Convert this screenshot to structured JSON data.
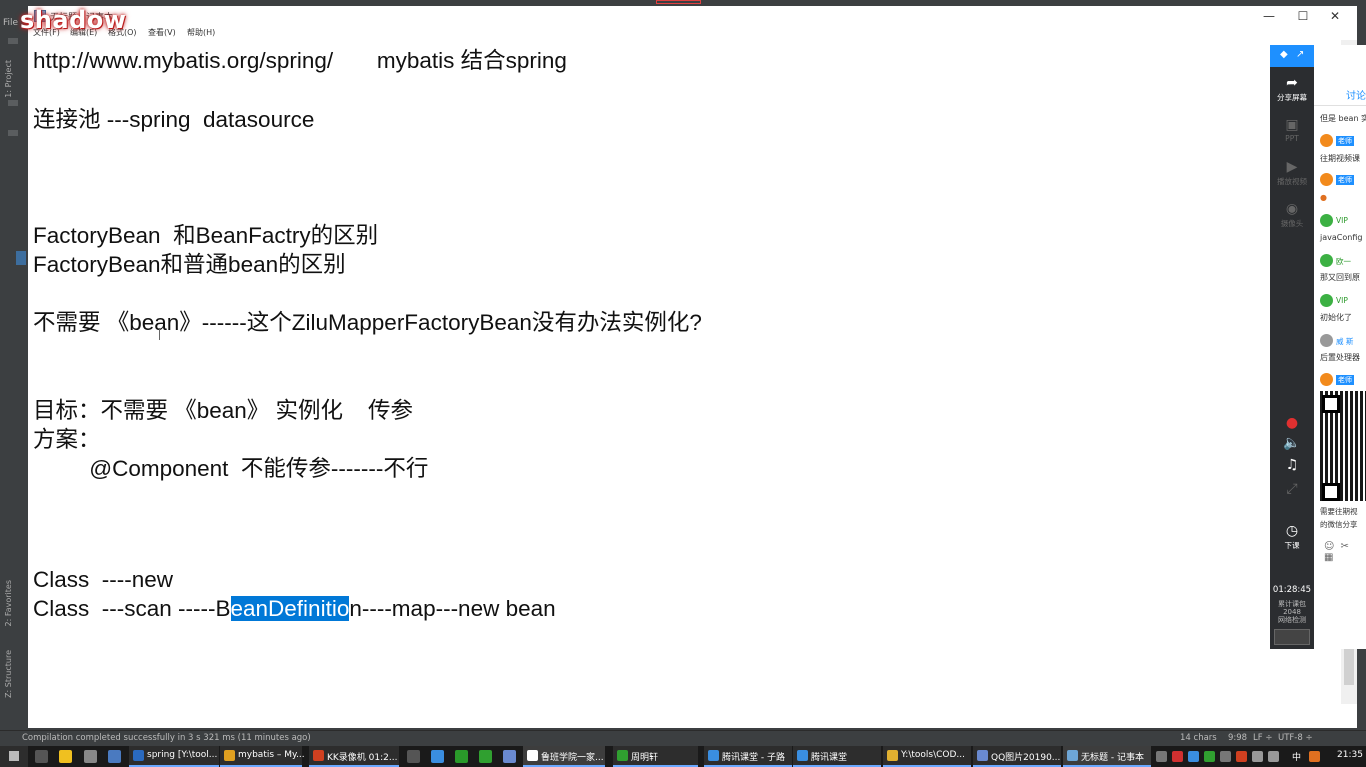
{
  "ide": {
    "tab_label": "sp",
    "menu_label": "File",
    "side_tabs": [
      "1: Project",
      "2: Favorites",
      "Z: Structure"
    ],
    "status_text": "Compilation completed successfully in 3 s 321 ms (11 minutes ago)",
    "status_right": [
      "14 chars",
      "9:98",
      "LF ÷",
      "UTF-8 ÷"
    ]
  },
  "overlay": {
    "logo_text": "shadow"
  },
  "notepad": {
    "title": "无标题 - 记事本",
    "menu": [
      "文件(F)",
      "编辑(E)",
      "格式(O)",
      "查看(V)",
      "帮助(H)"
    ],
    "window_buttons": [
      "—",
      "☐",
      "✕"
    ],
    "lines": {
      "l1": "http://www.mybatis.org/spring/       mybatis 结合spring",
      "l2": "连接池 ---spring  datasource",
      "l3": "FactoryBean  和BeanFactry的区别",
      "l4": "FactoryBean和普通bean的区别",
      "l5": "不需要 《bean》------这个ZiluMapperFactoryBean没有办法实例化?",
      "l6": "目标：不需要 《bean》 实例化    传参",
      "l7": "方案：",
      "l8": "         @Component  不能传参-------不行",
      "l9": "Class  ----new",
      "l10_pre": "Class  ---scan -----B",
      "l10_sel": "eanDefinitio",
      "l10_post": "n----map---new bean"
    }
  },
  "classroom": {
    "toolbar": [
      {
        "label": "分享屏幕",
        "icon": "share-screen-icon"
      },
      {
        "label": "PPT",
        "icon": "ppt-icon"
      },
      {
        "label": "播放视频",
        "icon": "play-video-icon"
      },
      {
        "label": "摄像头",
        "icon": "camera-icon"
      },
      {
        "label": "下课",
        "icon": "end-class-icon"
      }
    ],
    "timer": "01:28:45",
    "stats": [
      "累计课包",
      "2048",
      "网络检测"
    ],
    "discussion_tab": "讨论",
    "messages": [
      {
        "text": "但是 bean 实"
      },
      {
        "badge": "老师",
        "text": "往期视频课"
      },
      {
        "badge": "老师",
        "text": ""
      },
      {
        "name": "VIP",
        "text": "javaConfig"
      },
      {
        "name": "欧一",
        "text": "那又回到原"
      },
      {
        "name": "VIP",
        "text": "初始化了"
      },
      {
        "name": "威 斯",
        "text": "后置处理器"
      },
      {
        "badge": "老师",
        "text": ""
      }
    ],
    "qr_note": [
      "需要往期视",
      "的微信分享"
    ]
  },
  "taskbar": {
    "items": [
      {
        "label": "spring [Y:\\tool...",
        "color": "#2a6ac0"
      },
      {
        "label": "mybatis – My...",
        "color": "#e0a020"
      },
      {
        "label": "KK录像机 01:2...",
        "color": "#d04020"
      },
      {
        "label": "鲁班学院一家...",
        "color": "#ffffff"
      },
      {
        "label": "周明轩",
        "color": "#30a030"
      },
      {
        "label": "腾讯课堂 - 子路",
        "color": "#3a8ee0"
      },
      {
        "label": "腾讯课堂",
        "color": "#3a8ee0"
      },
      {
        "label": "Y:\\tools\\COD...",
        "color": "#e0b030"
      },
      {
        "label": "QQ图片20190...",
        "color": "#6a8ad0"
      },
      {
        "label": "无标题 - 记事本",
        "color": "#6ea6d6"
      }
    ],
    "tray_lang": "中",
    "clock": "21:35"
  },
  "colors": {
    "selection": "#0078d7",
    "classroom_blue": "#1e90ff",
    "taskbar": "#1a1a1a"
  }
}
